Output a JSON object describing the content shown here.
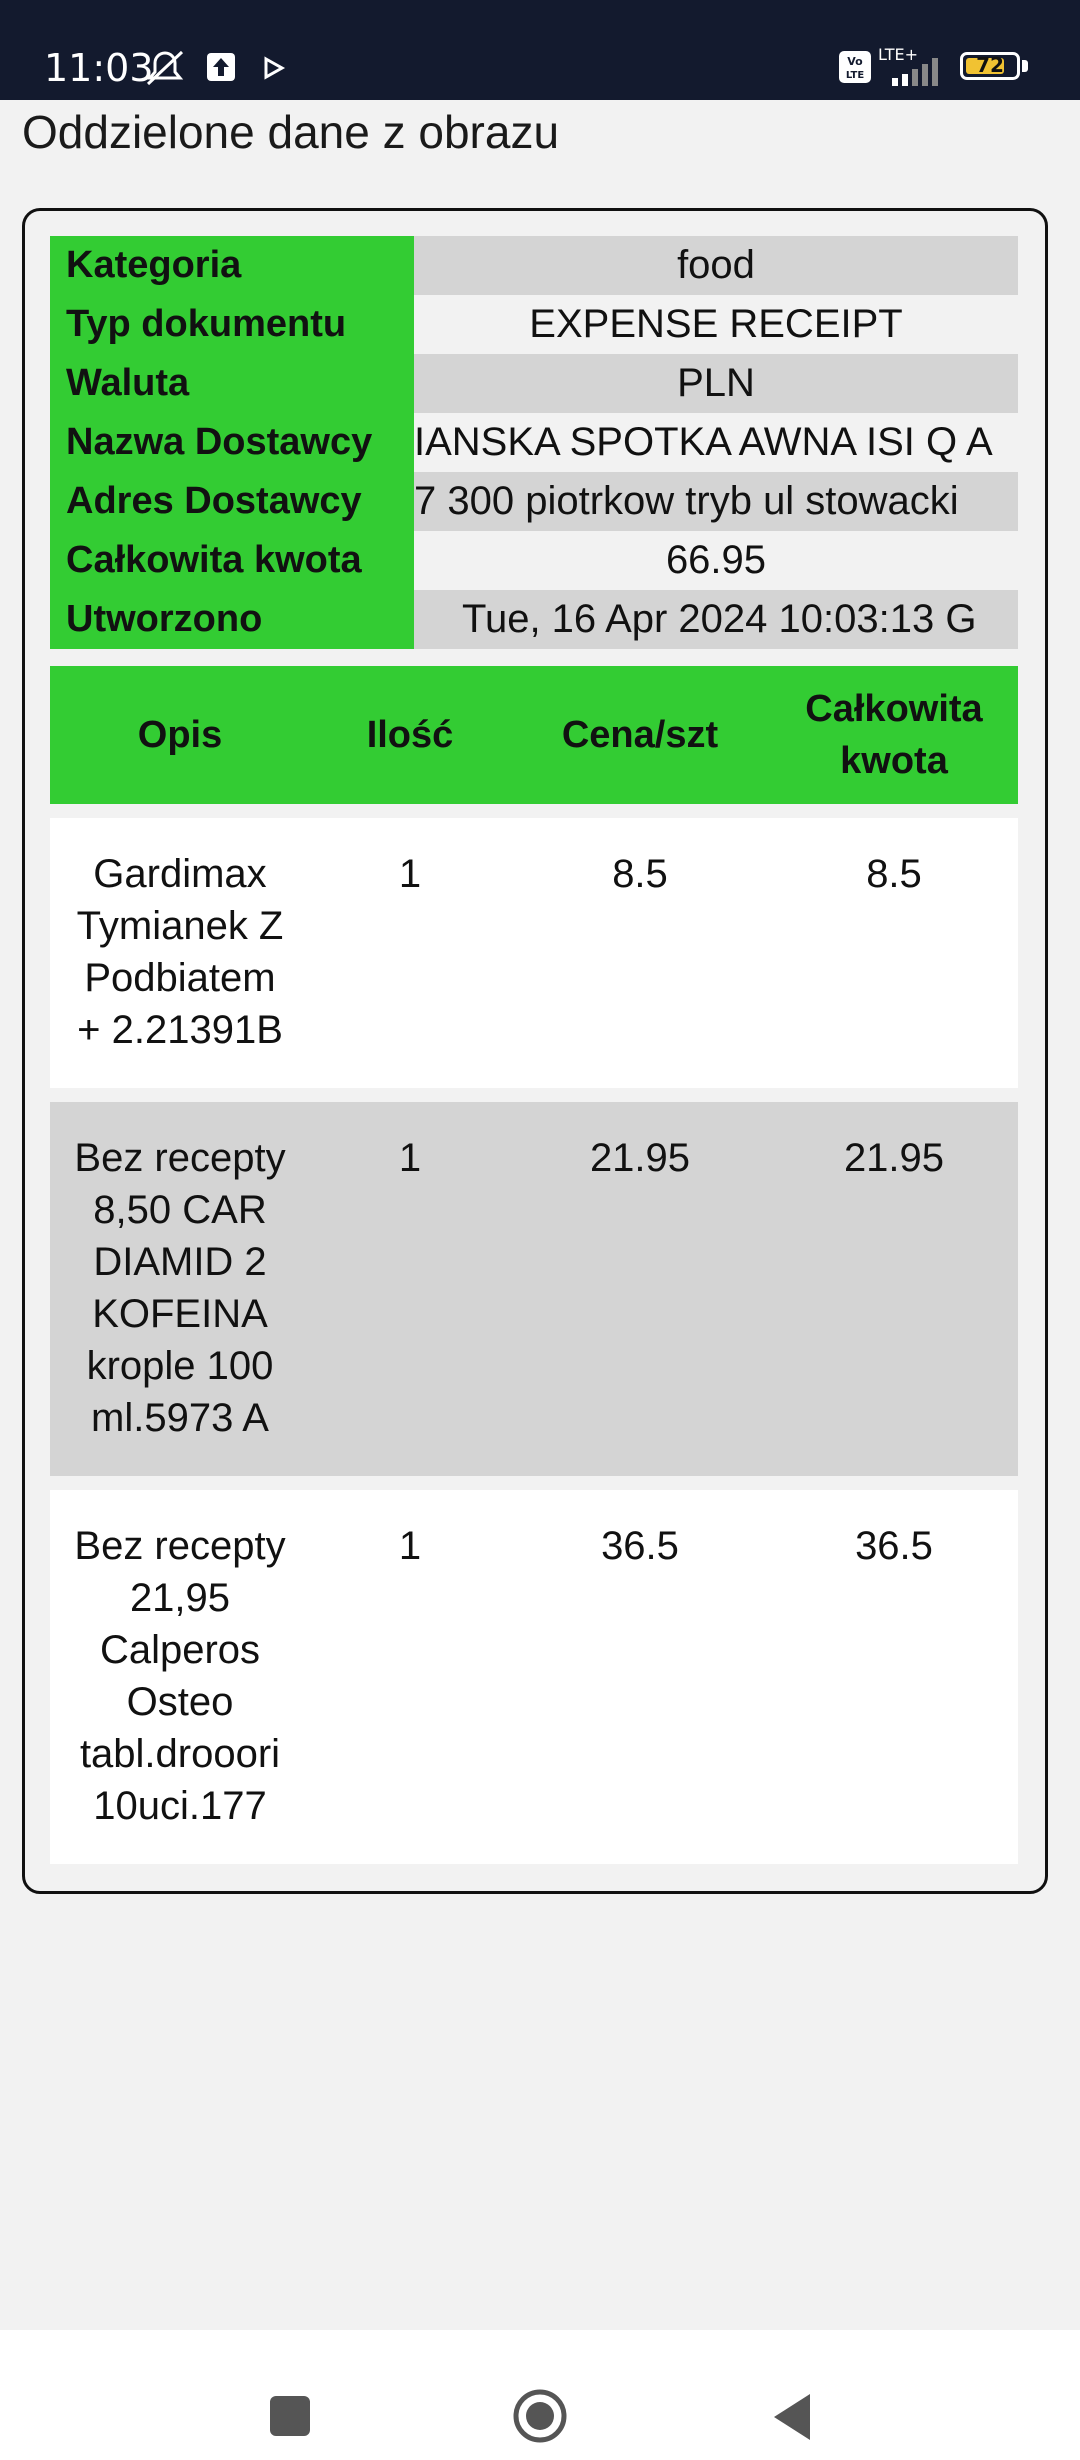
{
  "status_bar": {
    "time": "11:03",
    "network": "LTE+",
    "volte": "Vo LTE",
    "battery": "72",
    "icons": [
      "mute-icon",
      "upload-icon",
      "play-icon",
      "volte-icon",
      "signal-icon",
      "battery-icon"
    ]
  },
  "page": {
    "title": "Oddzielone dane z obrazu"
  },
  "info": [
    {
      "key": "Kategoria",
      "value": "food"
    },
    {
      "key": "Typ dokumentu",
      "value": "EXPENSE RECEIPT"
    },
    {
      "key": "Waluta",
      "value": "PLN"
    },
    {
      "key": "Nazwa Dostawcy",
      "value": "IANSKA SPOTKA AWNA ISI Q A"
    },
    {
      "key": "Adres Dostawcy",
      "value": "7 300 piotrkow tryb ul stowacki"
    },
    {
      "key": "Całkowita kwota",
      "value": "66.95"
    },
    {
      "key": "Utworzono",
      "value": "Tue, 16 Apr 2024 10:03:13 G"
    }
  ],
  "items_table": {
    "headers": {
      "description": "Opis",
      "quantity": "Ilość",
      "unit_price": "Cena/szt",
      "total_line1": "Całkowita",
      "total_line2": "kwota"
    },
    "rows": [
      {
        "description": [
          "Gardimax",
          "Tymianek Z",
          "Podbiatem",
          "+ 2.21391B"
        ],
        "quantity": "1",
        "unit_price": "8.5",
        "total": "8.5"
      },
      {
        "description": [
          "Bez recepty",
          "8,50 CAR",
          "DIAMID 2",
          "KOFEINA",
          "krople 100",
          "ml.5973 A"
        ],
        "quantity": "1",
        "unit_price": "21.95",
        "total": "21.95"
      },
      {
        "description": [
          "Bez recepty",
          "21,95",
          "Calperos",
          "Osteo",
          "tabl.drooori",
          "10uci.177"
        ],
        "quantity": "1",
        "unit_price": "36.5",
        "total": "36.5"
      }
    ]
  },
  "colors": {
    "header_green": "#33cc33",
    "row_grey": "#d4d4d4",
    "status_bar": "#131a2e"
  }
}
